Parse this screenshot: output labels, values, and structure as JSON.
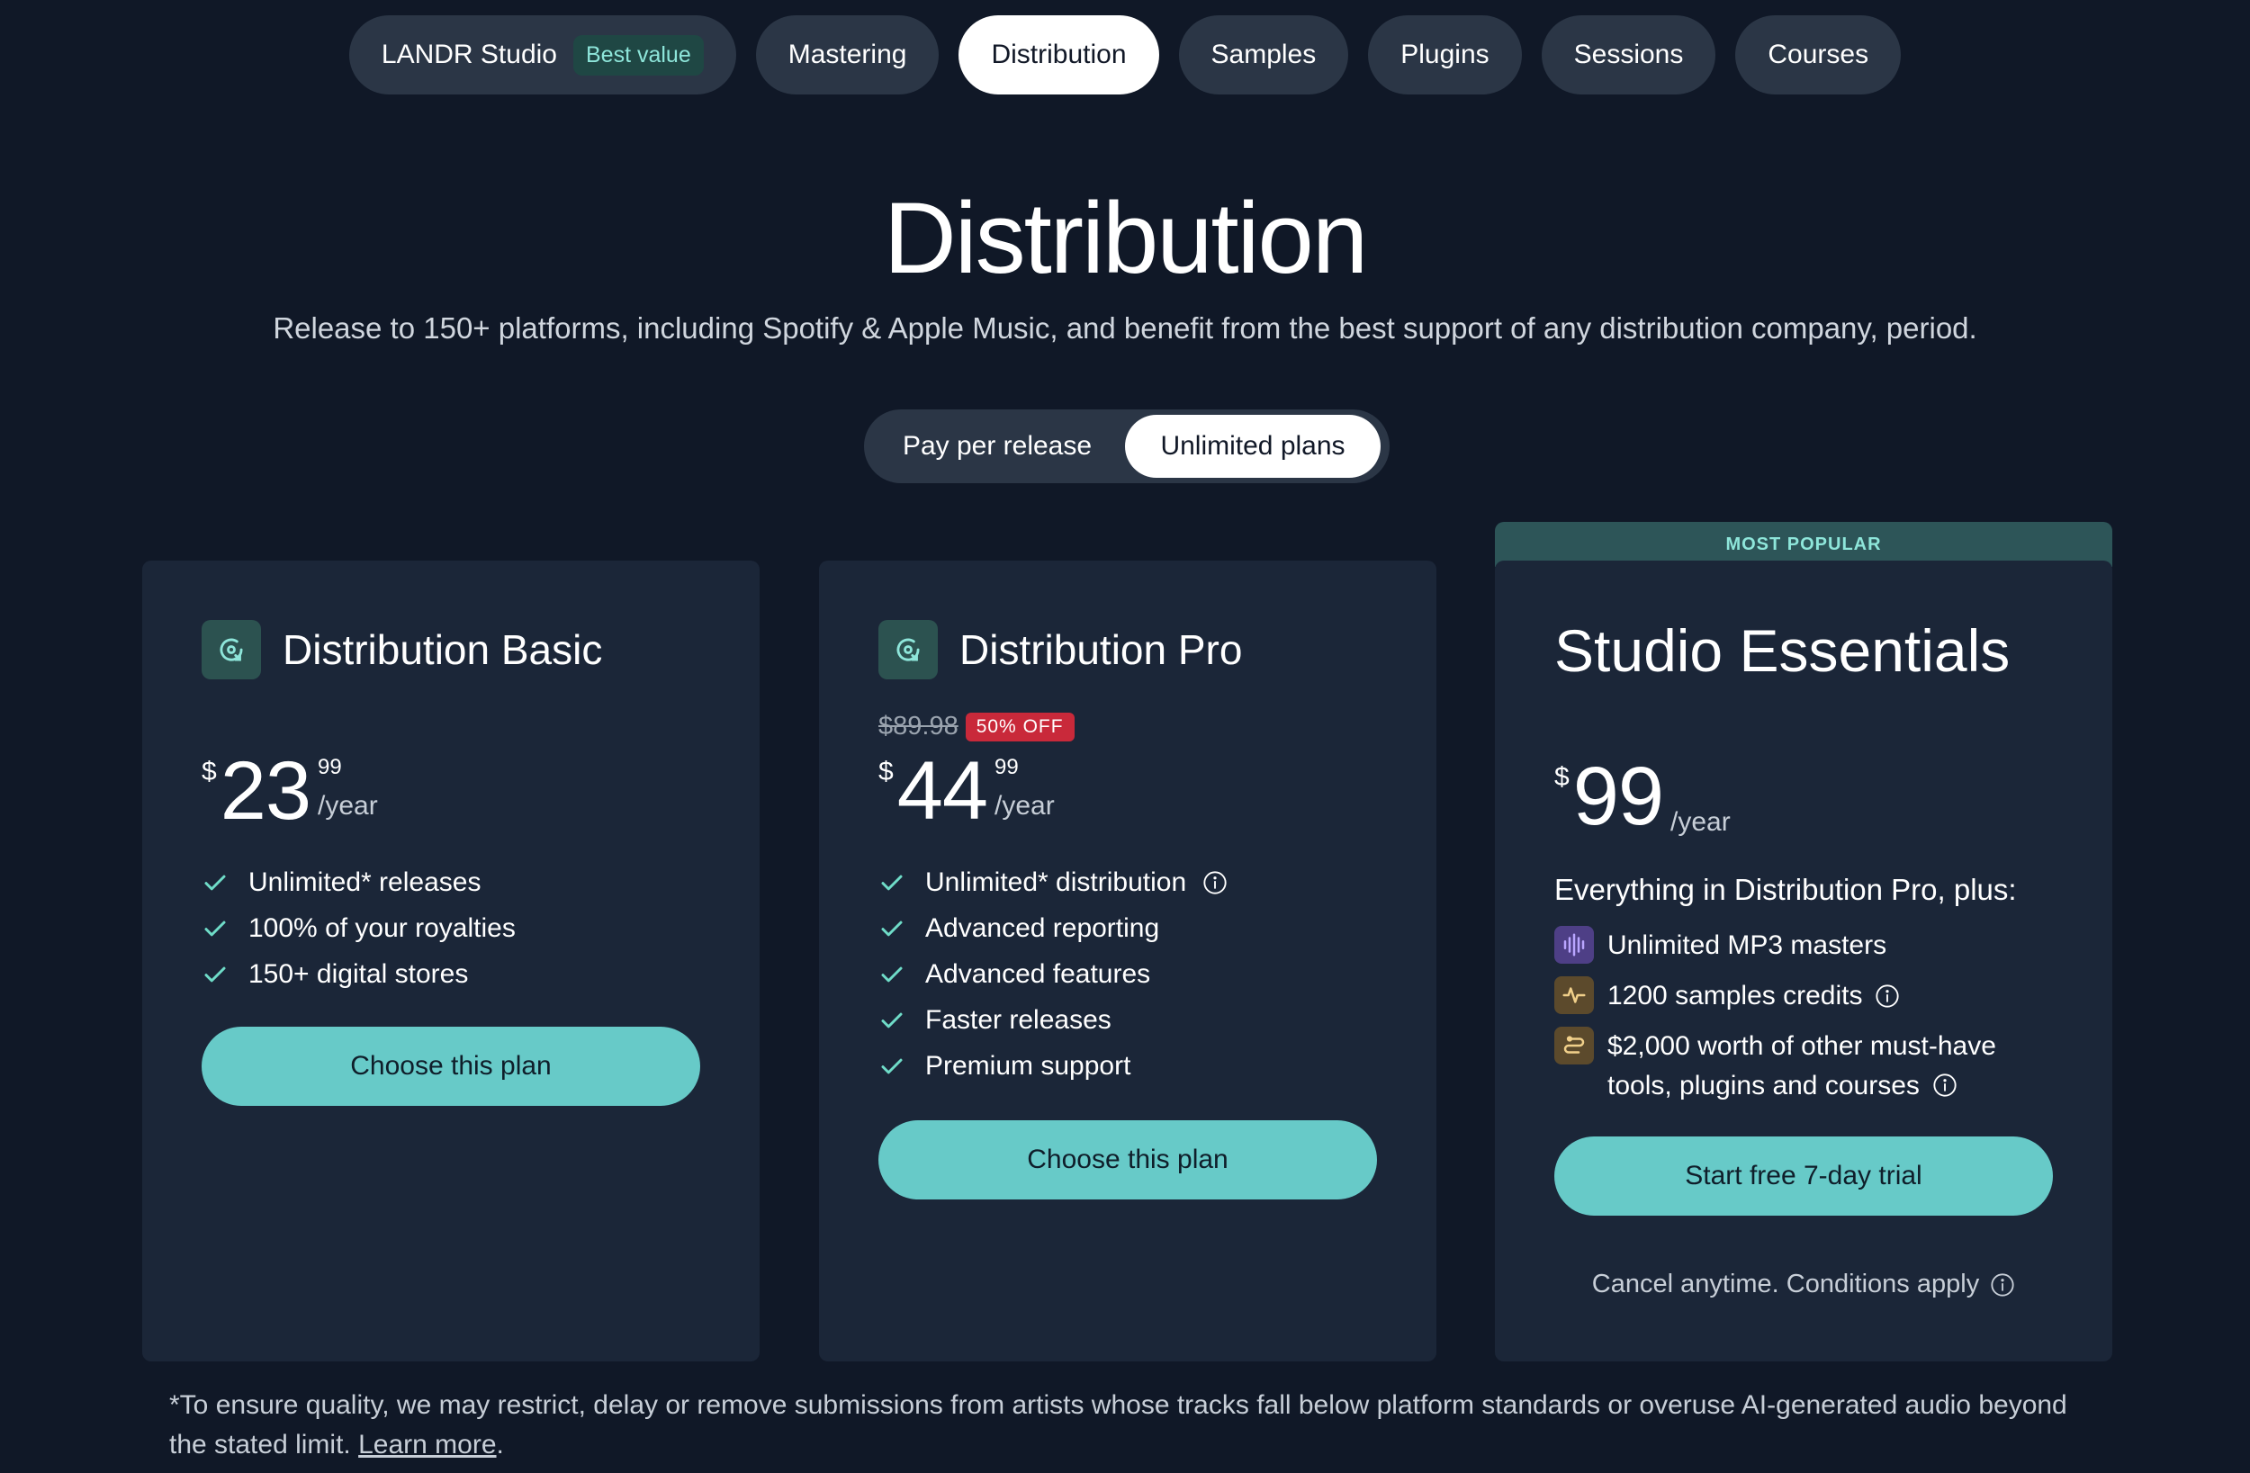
{
  "tabs": [
    {
      "label": "LANDR Studio",
      "badge": "Best value",
      "active": false
    },
    {
      "label": "Mastering",
      "active": false
    },
    {
      "label": "Distribution",
      "active": true
    },
    {
      "label": "Samples",
      "active": false
    },
    {
      "label": "Plugins",
      "active": false
    },
    {
      "label": "Sessions",
      "active": false
    },
    {
      "label": "Courses",
      "active": false
    }
  ],
  "hero": {
    "title": "Distribution",
    "subtitle": "Release to 150+ platforms, including Spotify & Apple Music, and benefit from the best support of any distribution company, period."
  },
  "toggle": {
    "options": [
      "Pay per release",
      "Unlimited plans"
    ],
    "selected": "Unlimited plans"
  },
  "colors": {
    "background": "#101827",
    "card": "#1b2638",
    "accent": "#67cac8",
    "discount": "#c9293a",
    "check": "#6fdcc8"
  },
  "plans": [
    {
      "name": "Distribution Basic",
      "icon": "distribution-disc-icon",
      "currency": "$",
      "price_whole": "23",
      "price_cents": "99",
      "period": "/year",
      "features": [
        "Unlimited* releases",
        "100% of your royalties",
        "150+ digital stores"
      ],
      "cta": "Choose this plan"
    },
    {
      "name": "Distribution Pro",
      "icon": "distribution-disc-icon",
      "old_price": "$89.98",
      "discount": "50% OFF",
      "currency": "$",
      "price_whole": "44",
      "price_cents": "99",
      "period": "/year",
      "features": [
        "Unlimited* distribution",
        "Advanced reporting",
        "Advanced features",
        "Faster releases",
        "Premium support"
      ],
      "cta": "Choose this plan"
    },
    {
      "banner": "MOST POPULAR",
      "name": "Studio Essentials",
      "currency": "$",
      "price_whole": "99",
      "period": "/year",
      "everything": "Everything in Distribution Pro, plus:",
      "extras": [
        {
          "icon": "waveform-icon",
          "text": "Unlimited MP3 masters"
        },
        {
          "icon": "pulse-icon",
          "text": "1200 samples credits"
        },
        {
          "icon": "plugin-icon",
          "text_line1": "$2,000 worth of other must-have",
          "text_line2": "tools, plugins and courses"
        }
      ],
      "cta": "Start free 7-day trial",
      "note": "Cancel anytime. Conditions apply"
    }
  ],
  "footnote": {
    "text": "*To ensure quality, we may restrict, delay or remove submissions from artists whose tracks fall below platform standards or overuse AI-generated audio beyond the stated limit.",
    "link": "Learn more",
    "end": "."
  }
}
